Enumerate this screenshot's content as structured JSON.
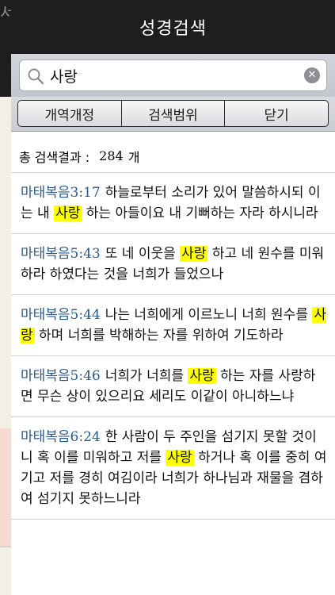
{
  "underlay": {
    "fragment": "서"
  },
  "title": "성경검색",
  "search": {
    "value": "사랑",
    "placeholder": ""
  },
  "tabs": [
    "개역개정",
    "검색범위",
    "닫기"
  ],
  "summary": {
    "label": "총 검색결과 :",
    "count": "284",
    "unit": "개"
  },
  "results": [
    {
      "ref": "마태복음3:17",
      "before": "하늘로부터 소리가 있어 말씀하시되 이는 내 ",
      "match": "사랑",
      "after": " 하는 아들이요 내 기뻐하는 자라 하시니라"
    },
    {
      "ref": "마태복음5:43",
      "before": "또 네 이웃을 ",
      "match": "사랑",
      "after": " 하고 네 원수를 미워하라 하였다는 것을 너희가 들었으나"
    },
    {
      "ref": "마태복음5:44",
      "before": "나는 너희에게 이르노니 너희 원수를 ",
      "match": "사랑",
      "after": " 하며 너희를 박해하는 자를 위하여 기도하라"
    },
    {
      "ref": "마태복음5:46",
      "before": "너희가 너희를 ",
      "match": "사랑",
      "after": " 하는 자를 사랑하면 무슨 상이 있으리요 세리도 이같이 아니하느냐"
    },
    {
      "ref": "마태복음6:24",
      "before": "한 사람이 두 주인을 섬기지 못할 것이니 혹 이를 미워하고 저를 ",
      "match": "사랑",
      "after": " 하거나 혹 이를 중히 여기고 저를 경히 여김이라 너희가 하나님과 재물을 겸하여 섬기지 못하느니라"
    }
  ]
}
